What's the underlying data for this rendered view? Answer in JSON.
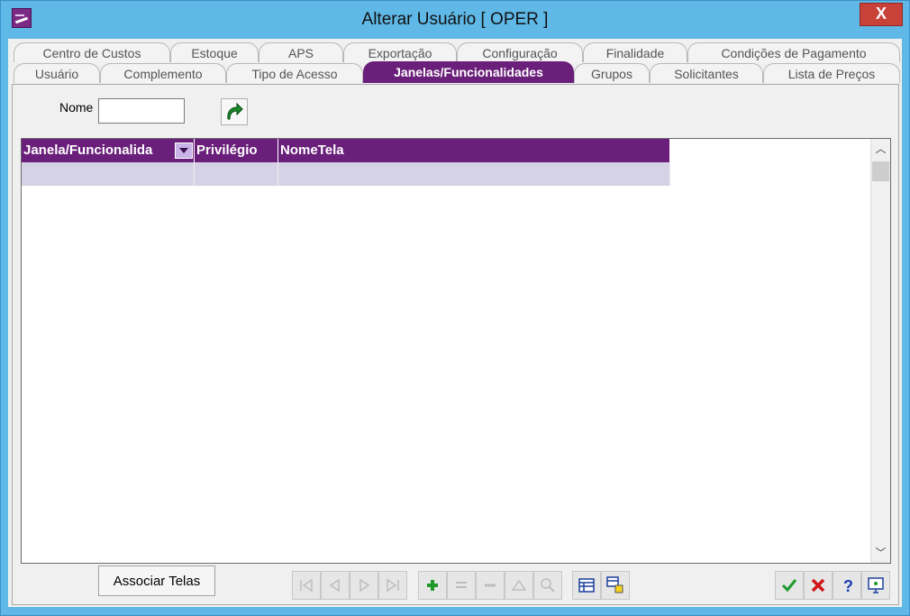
{
  "window": {
    "title": "Alterar Usuário [ OPER ]",
    "close_label": "X"
  },
  "tabs_row1": [
    "Centro de Custos",
    "Estoque",
    "APS",
    "Exportação",
    "Configuração",
    "Finalidade",
    "Condições de Pagamento"
  ],
  "tabs_row2": [
    "Usuário",
    "Complemento",
    "Tipo de Acesso",
    "Janelas/Funcionalidades",
    "Grupos",
    "Solicitantes",
    "Lista de Preços"
  ],
  "active_tab": "Janelas/Funcionalidades",
  "filter": {
    "label": "Nome",
    "value": ""
  },
  "grid": {
    "columns": [
      "Janela/Funcionalida",
      "Privilégio",
      "NomeTela"
    ]
  },
  "buttons": {
    "associar_telas": "Associar Telas"
  },
  "colors": {
    "accent": "#6a1f7a",
    "title_bar": "#5fb8e6",
    "close": "#c9423a",
    "row_fill": "#d6d2e6"
  }
}
